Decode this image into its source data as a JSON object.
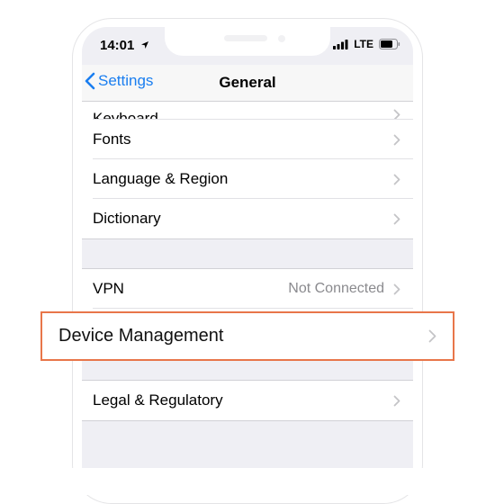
{
  "status_bar": {
    "time": "14:01",
    "network": "LTE"
  },
  "nav": {
    "back_label": "Settings",
    "title": "General"
  },
  "groups": [
    {
      "items": [
        {
          "label": "Keyboard"
        },
        {
          "label": "Fonts"
        },
        {
          "label": "Language & Region"
        },
        {
          "label": "Dictionary"
        }
      ]
    },
    {
      "items": [
        {
          "label": "VPN",
          "value": "Not Connected"
        }
      ]
    },
    {
      "items": [
        {
          "label": "Legal & Regulatory"
        }
      ]
    }
  ],
  "highlighted_item": {
    "label": "Device Management"
  },
  "colors": {
    "accent": "#1a7ef0",
    "highlight_border": "#e8764a",
    "grouped_background": "#efeff4"
  },
  "icons": [
    "location-arrow-icon",
    "cellular-signal-icon",
    "battery-icon",
    "chevron-left-icon",
    "chevron-right-icon"
  ]
}
